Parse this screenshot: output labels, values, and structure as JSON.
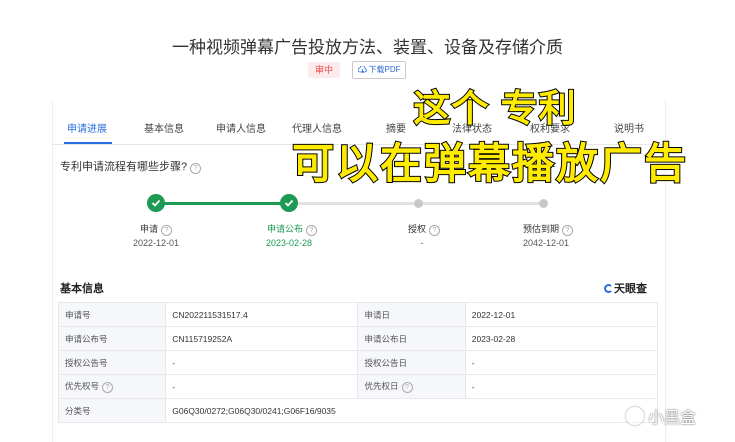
{
  "header": {
    "title": "一种视频弹幕广告投放方法、装置、设备及存储介质",
    "status_badge": "审中",
    "download_label": "下载PDF"
  },
  "tabs": [
    "申请进展",
    "基本信息",
    "申请人信息",
    "代理人信息",
    "摘要",
    "法律状态",
    "权利要求",
    "说明书"
  ],
  "active_tab": "申请进展",
  "progress": {
    "question": "专利申请流程有哪些步骤?",
    "steps": [
      {
        "label": "申请",
        "date": "2022-12-01",
        "state": "done"
      },
      {
        "label": "申请公布",
        "date": "2023-02-28",
        "state": "done"
      },
      {
        "label": "授权",
        "date": "-",
        "state": "pending"
      },
      {
        "label": "预估到期",
        "date": "2042-12-01",
        "state": "pending"
      }
    ],
    "accent_color": "#1d9a53"
  },
  "basic_info": {
    "title": "基本信息",
    "brand": "天眼查",
    "rows": [
      {
        "k1": "申请号",
        "v1": "CN202211531517.4",
        "k2": "申请日",
        "v2": "2022-12-01"
      },
      {
        "k1": "申请公布号",
        "v1": "CN115719252A",
        "k2": "申请公布日",
        "v2": "2023-02-28"
      },
      {
        "k1": "授权公告号",
        "v1": "-",
        "k2": "授权公告日",
        "v2": "-"
      },
      {
        "k1": "优先权号",
        "v1": "-",
        "k2": "优先权日",
        "v2": "-"
      },
      {
        "k1": "分类号",
        "v1": "G06Q30/0272;G06Q30/0241;G06F16/9035",
        "k2": "",
        "v2": ""
      }
    ]
  },
  "overlay": {
    "line1": "这个 专利",
    "line2": "可以在弹幕播放广告",
    "color": "#ffeb00"
  },
  "watermark": "小黑盒"
}
